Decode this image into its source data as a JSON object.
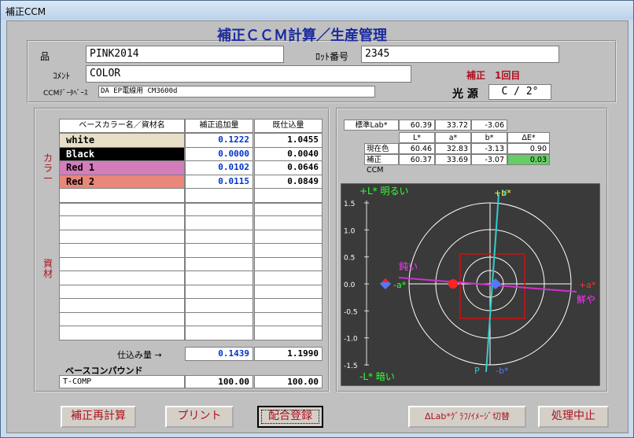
{
  "window_title": "補正CCM",
  "form_title": "補正ＣＣＭ計算／生産管理",
  "product": {
    "label": "品",
    "value": "PINK2014"
  },
  "lot": {
    "label": "ﾛｯﾄ番号",
    "value": "2345"
  },
  "comment": {
    "label": "ｺﾒﾝﾄ",
    "value": "COLOR"
  },
  "correction_no": "補正　1回目",
  "db": {
    "label": "CCMﾃﾞｰﾀﾍﾞｰｽ",
    "value": "DA EP電線用 CM3600d"
  },
  "light": {
    "label": "光 源",
    "value": "C / 2°"
  },
  "side_color": "カラー",
  "side_material": "資材",
  "table": {
    "headers": [
      "ベースカラー名／資材名",
      "補正追加量",
      "既仕込量"
    ],
    "rows": [
      {
        "name": "white",
        "add": "0.1222",
        "existing": "1.0455",
        "bg": "#e8dfc8",
        "fg": "#000000"
      },
      {
        "name": "Black",
        "add": "0.0000",
        "existing": "0.0040",
        "bg": "#000000",
        "fg": "#ffffff"
      },
      {
        "name": "Red 1",
        "add": "0.0102",
        "existing": "0.0646",
        "bg": "#d47cbc",
        "fg": "#000000"
      },
      {
        "name": "Red 2",
        "add": "0.0115",
        "existing": "0.0849",
        "bg": "#e8877a",
        "fg": "#000000"
      }
    ],
    "total_label": "仕込み量 →",
    "total_add": "0.1439",
    "total_existing": "1.1990",
    "compound_label": "ベースコンパウンド",
    "compound": {
      "name": "T-COMP",
      "add": "100.00",
      "existing": "100.00"
    }
  },
  "lab": {
    "standard_label": "標準Lab*",
    "standard": [
      "60.39",
      "33.72",
      "-3.06"
    ],
    "headers": [
      "L*",
      "a*",
      "b*",
      "ΔE*"
    ],
    "rows": [
      {
        "label": "現在色",
        "values": [
          "60.46",
          "32.83",
          "-3.13",
          "0.90"
        ]
      },
      {
        "label": "補正CCM",
        "values": [
          "60.37",
          "33.69",
          "-3.07",
          "0.03"
        ]
      }
    ]
  },
  "graph": {
    "label_top_left": "+L* 明るい",
    "label_bottom_left": "-L* 暗い",
    "label_top": "+b*",
    "label_top_y": "Y",
    "label_bottom": "-b*",
    "label_bottom_p": "P",
    "label_left_a": "-a*",
    "label_dull": "鈍い",
    "label_right_a": "+a*",
    "label_vivid": "鮮や",
    "ticks": [
      "1.5",
      "1.0",
      "0.5",
      "0.0",
      "-0.5",
      "-1.0",
      "-1.5"
    ],
    "current_dL": 0.07,
    "current_da": -0.89,
    "current_db": -0.07
  },
  "colors": {
    "accent": "#b01020",
    "title": "#1b2aa0",
    "value_blue": "#0033cc",
    "ok_green": "#66cc66"
  },
  "buttons": [
    "補正再計算",
    "プリント",
    "配合登録",
    "ΔLab*ｸﾞﾗﾌ/ｲﾒｰｼﾞ切替",
    "処理中止"
  ]
}
